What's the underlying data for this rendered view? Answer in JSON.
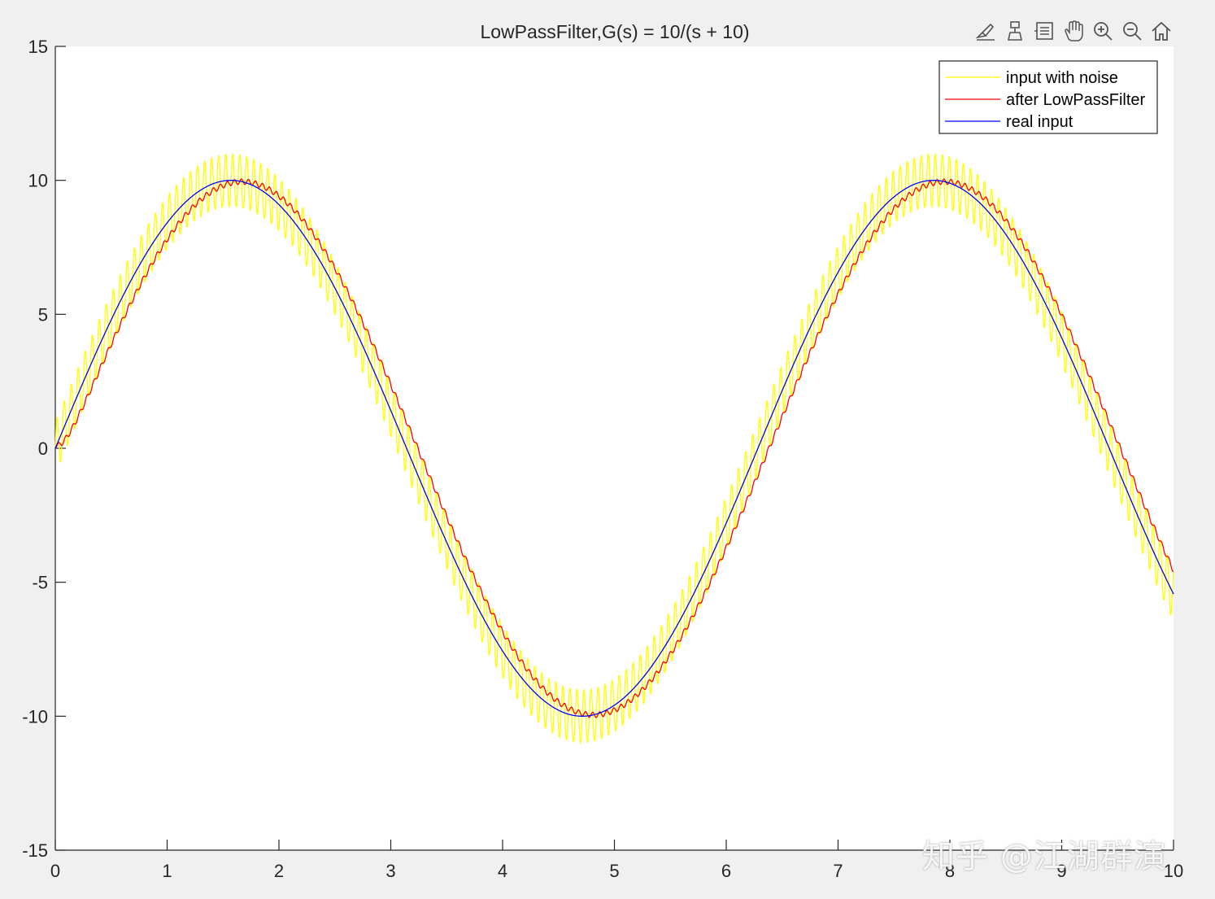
{
  "toolbar": {
    "tools": [
      "brush-icon",
      "data-tip-icon",
      "legend-toggle-icon",
      "pan-icon",
      "zoom-in-icon",
      "zoom-out-icon",
      "home-icon"
    ]
  },
  "watermark": {
    "text": "知乎 @江湖群演"
  },
  "chart_data": {
    "type": "line",
    "title": "LowPassFilter,G(s) = 10/(s + 10)",
    "xlabel": "",
    "ylabel": "",
    "xlim": [
      0,
      10
    ],
    "ylim": [
      -15,
      15
    ],
    "xticks": [
      0,
      1,
      2,
      3,
      4,
      5,
      6,
      7,
      8,
      9,
      10
    ],
    "xtick_labels": [
      "0",
      "1",
      "2",
      "3",
      "4",
      "5",
      "6",
      "7",
      "8",
      "9",
      "10"
    ],
    "yticks": [
      -15,
      -10,
      -5,
      0,
      5,
      10,
      15
    ],
    "ytick_labels": [
      "-15",
      "-10",
      "-5",
      "0",
      "5",
      "10",
      "15"
    ],
    "grid": false,
    "legend_position": "top-right",
    "series": [
      {
        "name": "input with noise",
        "color": "#ffff00",
        "formula": "10*sin(t) + 1*sin(100*t)",
        "t_start": 0,
        "t_end": 10,
        "samples": 2001
      },
      {
        "name": "after LowPassFilter",
        "color": "#ff0000",
        "formula": "y' = 10*(u - y), u = input with noise",
        "t_start": 0,
        "t_end": 10,
        "samples": 2001
      },
      {
        "name": "real input",
        "color": "#0000ff",
        "formula": "10*sin(t)",
        "t_start": 0,
        "t_end": 10,
        "samples": 2001
      }
    ]
  }
}
